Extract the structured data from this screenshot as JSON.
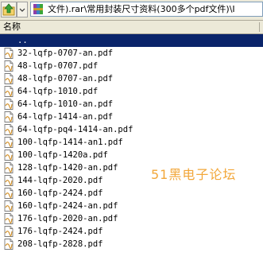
{
  "toolbar": {
    "up_button_icon": "up-arrow-icon",
    "archive_icon": "rar-archive-icon",
    "path": "文件).rar\\常用封装尺寸资料(300多个pdf文件)\\I"
  },
  "columns": {
    "name_header": "名称"
  },
  "files": [
    {
      "name": "..",
      "selected": true
    },
    {
      "name": "32-lqfp-0707-an.pdf"
    },
    {
      "name": "48-lqfp-0707.pdf"
    },
    {
      "name": "48-lqfp-0707-an.pdf"
    },
    {
      "name": "64-lqfp-1010.pdf"
    },
    {
      "name": "64-lqfp-1010-an.pdf"
    },
    {
      "name": "64-lqfp-1414-an.pdf"
    },
    {
      "name": "64-lqfp-pq4-1414-an.pdf"
    },
    {
      "name": "100-lqfp-1414-an1.pdf"
    },
    {
      "name": "100-lqfp-1420a.pdf"
    },
    {
      "name": "128-lqfp-1420-an.pdf"
    },
    {
      "name": "144-lqfp-2020.pdf"
    },
    {
      "name": "160-lqfp-2424.pdf"
    },
    {
      "name": "160-lqfp-2424-an.pdf"
    },
    {
      "name": "176-lqfp-2020-an.pdf"
    },
    {
      "name": "176-lqfp-2424.pdf"
    },
    {
      "name": "208-lqfp-2828.pdf"
    }
  ],
  "watermark": "51黑电子论坛",
  "colors": {
    "selection": "#0a246a",
    "watermark": "#f2a73a",
    "chrome": "#ece9d8"
  }
}
